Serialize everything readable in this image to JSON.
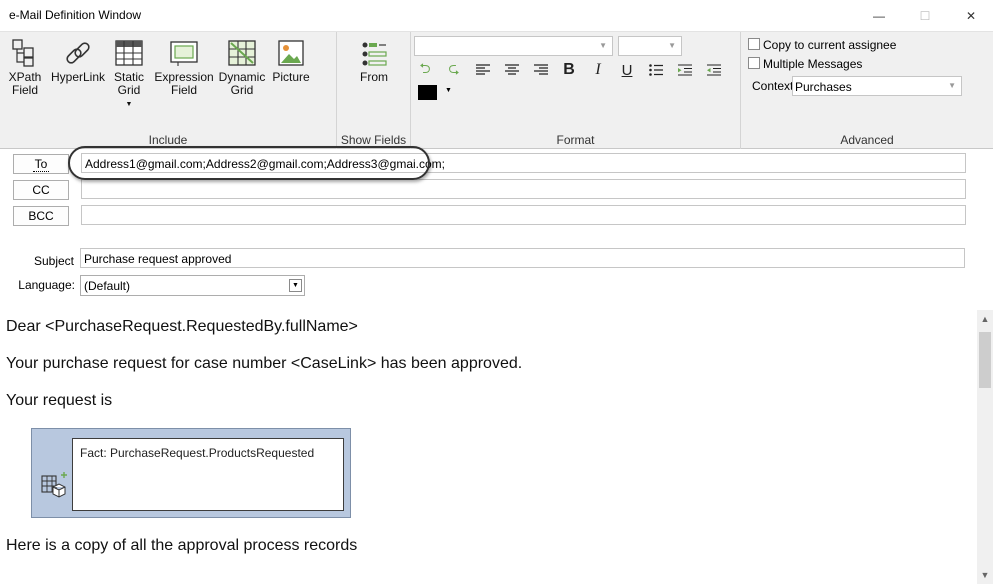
{
  "window": {
    "title": "e-Mail Definition Window",
    "minimize_glyph": "—",
    "maximize_glyph": "☐",
    "close_glyph": "✕"
  },
  "ribbon": {
    "include": {
      "label": "Include",
      "buttons": [
        {
          "label": "XPath\nField",
          "icon": "xpath-field-icon"
        },
        {
          "label": "HyperLink",
          "icon": "hyperlink-icon"
        },
        {
          "label": "Static\nGrid",
          "icon": "static-grid-icon"
        },
        {
          "label": "Expression\nField",
          "icon": "expression-field-icon"
        },
        {
          "label": "Dynamic\nGrid",
          "icon": "dynamic-grid-icon"
        },
        {
          "label": "Picture",
          "icon": "picture-icon"
        }
      ]
    },
    "show_fields": {
      "label": "Show Fields",
      "from_label": "From"
    },
    "format": {
      "label": "Format",
      "font_value": "",
      "size_value": "",
      "font_color": "#000000"
    },
    "advanced": {
      "label": "Advanced",
      "copy_to_assignee_label": "Copy to current assignee",
      "multiple_messages_label": "Multiple Messages",
      "context_label": "Context",
      "context_value": "Purchases"
    }
  },
  "address": {
    "to_label": "To",
    "to_value": "Address1@gmail.com;Address2@gmail.com;Address3@gmai.com;",
    "cc_label": "CC",
    "cc_value": "",
    "bcc_label": "BCC",
    "bcc_value": ""
  },
  "subject": {
    "label": "Subject",
    "value": "Purchase request approved"
  },
  "language": {
    "label": "Language:",
    "value": "(Default)"
  },
  "body": {
    "line1": "Dear <PurchaseRequest.RequestedBy.fullName>",
    "line2": "Your purchase request for case number <CaseLink> has been approved.",
    "line3": "Your request is",
    "fact_text": "Fact: PurchaseRequest.ProductsRequested",
    "line4": "Here is a copy of all the approval process records"
  },
  "colors": {
    "ribbon_bg": "#f0f0f0",
    "fact_box_bg": "#b8c8df",
    "accent_green": "#6aa84f"
  }
}
